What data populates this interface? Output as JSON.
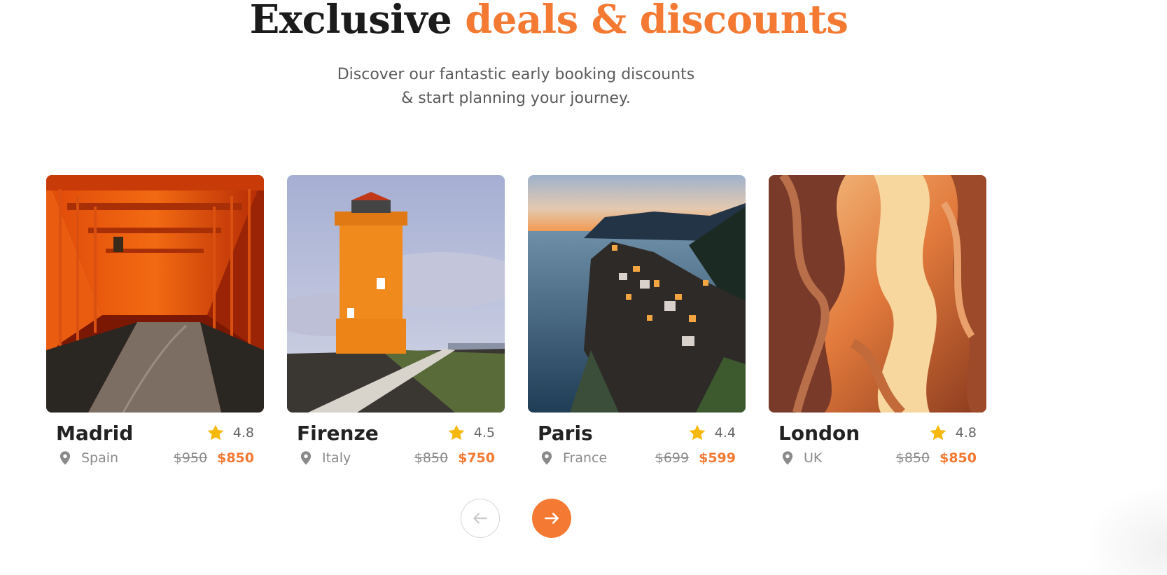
{
  "header": {
    "title_plain": "Exclusive",
    "title_accent": "deals & discounts",
    "subtitle_line1": "Discover our fantastic early booking discounts",
    "subtitle_line2": "& start planning your journey."
  },
  "colors": {
    "accent": "#f47932",
    "star": "#f6b80b",
    "text_dark": "#222222",
    "text_muted": "#8a8a8a"
  },
  "cards": [
    {
      "city": "Madrid",
      "rating": "4.8",
      "country": "Spain",
      "old_price": "$950",
      "new_price": "$850",
      "image": "orange torii gate tunnel path"
    },
    {
      "city": "Firenze",
      "rating": "4.5",
      "country": "Italy",
      "old_price": "$850",
      "new_price": "$750",
      "image": "orange lighthouse with boardwalk"
    },
    {
      "city": "Paris",
      "rating": "4.4",
      "country": "France",
      "old_price": "$699",
      "new_price": "$599",
      "image": "coastal cliff village at dusk"
    },
    {
      "city": "London",
      "rating": "4.8",
      "country": "UK",
      "old_price": "$850",
      "new_price": "$850",
      "image": "sandstone slot canyon"
    }
  ],
  "nav": {
    "prev_icon": "arrow-left-icon",
    "next_icon": "arrow-right-icon"
  }
}
